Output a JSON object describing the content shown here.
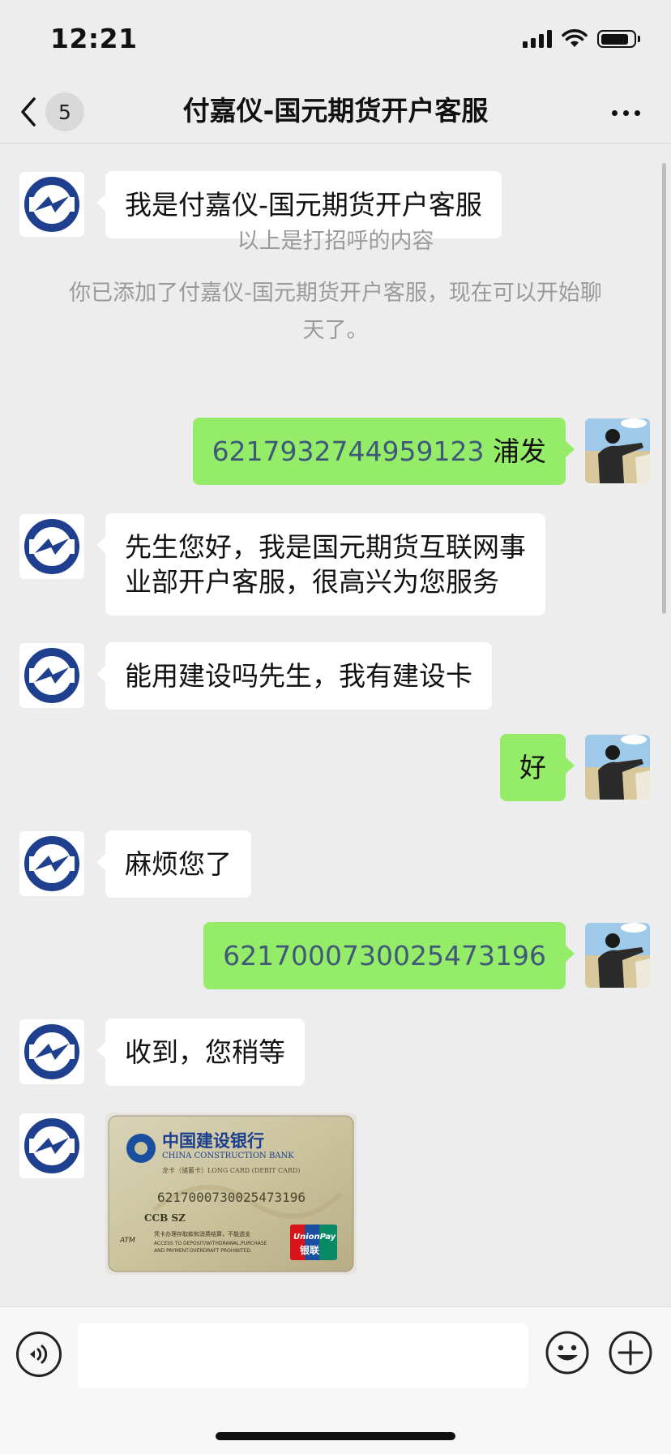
{
  "status_bar": {
    "time": "12:21",
    "icons": [
      "cellular-signal-icon",
      "wifi-icon",
      "battery-icon"
    ]
  },
  "nav": {
    "back_icon": "chevron-left-icon",
    "unread_count": "5",
    "title": "付嘉仪-国元期货开户客服",
    "more_icon": "more-dots-icon"
  },
  "messages": {
    "m1": {
      "from": "contact",
      "text": "我是付嘉仪-国元期货开户客服"
    },
    "sys1": "以上是打招呼的内容",
    "sys2_line1": "你已添加了付嘉仪-国元期货开户客服，现在可以开始聊",
    "sys2_line2": "天了。",
    "m2": {
      "from": "me",
      "number": "6217932744959123",
      "suffix": " 浦发"
    },
    "m3": {
      "from": "contact",
      "line1": "先生您好，我是国元期货互联网事",
      "line2": "业部开户客服，很高兴为您服务"
    },
    "m4": {
      "from": "contact",
      "text": "能用建设吗先生，我有建设卡"
    },
    "m5": {
      "from": "me",
      "text": "好"
    },
    "m6": {
      "from": "contact",
      "text": "麻烦您了"
    },
    "m7": {
      "from": "me",
      "number": "6217000730025473196"
    },
    "m8": {
      "from": "contact",
      "text": "收到，您稍等"
    },
    "m9": {
      "from": "contact",
      "type": "image",
      "card": {
        "bank_cn": "中国建设银行",
        "bank_en": "CHINA CONSTRUCTION BANK",
        "card_type": "龙卡（储蓄卡）LONG CARD (DEBIT CARD)",
        "card_number": "6217000730025473196",
        "branch": "CCB SZ",
        "atm": "ATM",
        "notice_cn": "凭卡办理存取款和消费结算，不能透支",
        "notice_en1": "ACCESS TO DEPOSIT/WITHDRAWAL,PURCHASE",
        "notice_en2": "AND PAYMENT.OVERDRAFT PROHIBITED.",
        "unionpay_en": "UnionPay",
        "unionpay_cn": "银联"
      }
    }
  },
  "input_bar": {
    "voice_icon": "voice-icon",
    "text_value": "",
    "emoji_icon": "emoji-icon",
    "plus_icon": "plus-icon"
  },
  "colors": {
    "background": "#ededed",
    "incoming_bubble": "#ffffff",
    "outgoing_bubble": "#95ec69",
    "number_link": "#3e5a78",
    "system_text": "#9a9a9a",
    "contact_logo": "#1f3f8f"
  }
}
